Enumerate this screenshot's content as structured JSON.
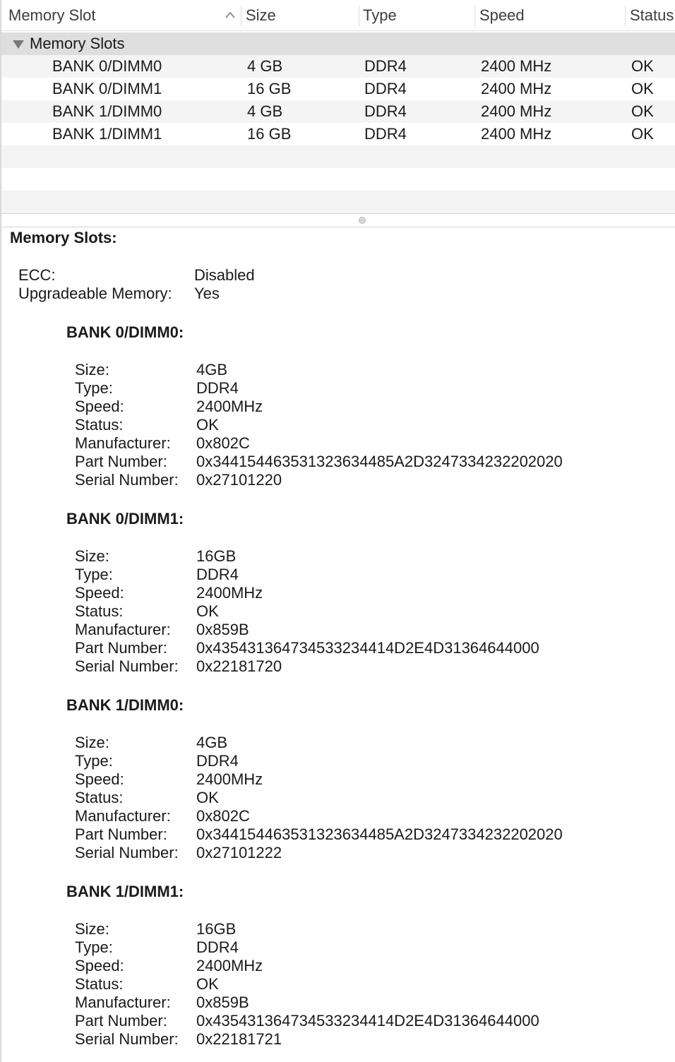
{
  "table": {
    "columns": [
      "Memory Slot",
      "Size",
      "Type",
      "Speed",
      "Status"
    ],
    "group_label": "Memory Slots",
    "rows": [
      {
        "slot": "BANK 0/DIMM0",
        "size": "4 GB",
        "type": "DDR4",
        "speed": "2400 MHz",
        "status": "OK"
      },
      {
        "slot": "BANK 0/DIMM1",
        "size": "16 GB",
        "type": "DDR4",
        "speed": "2400 MHz",
        "status": "OK"
      },
      {
        "slot": "BANK 1/DIMM0",
        "size": "4 GB",
        "type": "DDR4",
        "speed": "2400 MHz",
        "status": "OK"
      },
      {
        "slot": "BANK 1/DIMM1",
        "size": "16 GB",
        "type": "DDR4",
        "speed": "2400 MHz",
        "status": "OK"
      }
    ]
  },
  "detail": {
    "title": "Memory Slots:",
    "summary": [
      {
        "label": "ECC:",
        "value": "Disabled"
      },
      {
        "label": "Upgradeable Memory:",
        "value": "Yes"
      }
    ],
    "banks": [
      {
        "title": "BANK 0/DIMM0:",
        "fields": [
          {
            "label": "Size:",
            "value": "4 GB"
          },
          {
            "label": "Type:",
            "value": "DDR4"
          },
          {
            "label": "Speed:",
            "value": "2400 MHz"
          },
          {
            "label": "Status:",
            "value": "OK"
          },
          {
            "label": "Manufacturer:",
            "value": "0x802C"
          },
          {
            "label": "Part Number:",
            "value": "0x34415446353132363448 5A2D3247334232202020"
          },
          {
            "label": "Serial Number:",
            "value": "0x27101220"
          }
        ]
      },
      {
        "title": "BANK 0/DIMM1:",
        "fields": [
          {
            "label": "Size:",
            "value": "16 GB"
          },
          {
            "label": "Type:",
            "value": "DDR4"
          },
          {
            "label": "Speed:",
            "value": "2400 MHz"
          },
          {
            "label": "Status:",
            "value": "OK"
          },
          {
            "label": "Manufacturer:",
            "value": "0x859B"
          },
          {
            "label": "Part Number:",
            "value": "0x435431364734533234414D2E4D31364644000"
          },
          {
            "label": "Serial Number:",
            "value": "0x22181720"
          }
        ]
      },
      {
        "title": "BANK 1/DIMM0:",
        "fields": [
          {
            "label": "Size:",
            "value": "4 GB"
          },
          {
            "label": "Type:",
            "value": "DDR4"
          },
          {
            "label": "Speed:",
            "value": "2400 MHz"
          },
          {
            "label": "Status:",
            "value": "OK"
          },
          {
            "label": "Manufacturer:",
            "value": "0x802C"
          },
          {
            "label": "Part Number:",
            "value": "0x34415446353132363448 5A2D3247334232202020"
          },
          {
            "label": "Serial Number:",
            "value": "0x27101222"
          }
        ]
      },
      {
        "title": "BANK 1/DIMM1:",
        "fields": [
          {
            "label": "Size:",
            "value": "16 GB"
          },
          {
            "label": "Type:",
            "value": "DDR4"
          },
          {
            "label": "Speed:",
            "value": "2400 MHz"
          },
          {
            "label": "Status:",
            "value": "OK"
          },
          {
            "label": "Manufacturer:",
            "value": "0x859B"
          },
          {
            "label": "Part Number:",
            "value": "0x435431364734533234414D2E4D31364644000"
          },
          {
            "label": "Serial Number:",
            "value": "0x22181721"
          }
        ]
      }
    ]
  }
}
